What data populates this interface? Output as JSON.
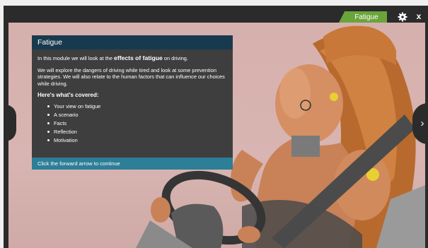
{
  "header": {
    "tab_label": "Fatigue",
    "close_label": "x"
  },
  "panel": {
    "title": "Fatigue",
    "intro_prefix": "In this module we will look at the ",
    "intro_strong": "effects of fatigue",
    "intro_suffix": " on driving.",
    "paragraph2": "We will explore the dangers of driving while tired and look at some prevention strategies. We will also relate to the human factors that can influence our choices while driving.",
    "covered_heading": "Here's what's covered:",
    "items": [
      "Your view on fatigue",
      "A scenario",
      "Facts",
      "Reflection",
      "Motivation"
    ],
    "footer": "Click the forward arrow to continue"
  },
  "nav": {
    "next_glyph": "›"
  },
  "colors": {
    "tab_green": "#6aa53a",
    "panel_header": "#183a4e",
    "panel_body": "#3e3e3e",
    "panel_footer": "#2d7e97",
    "background_pink": "#d6b0ad"
  },
  "icons": [
    "gear-icon",
    "close-icon",
    "chevron-left-icon",
    "chevron-right-icon"
  ]
}
